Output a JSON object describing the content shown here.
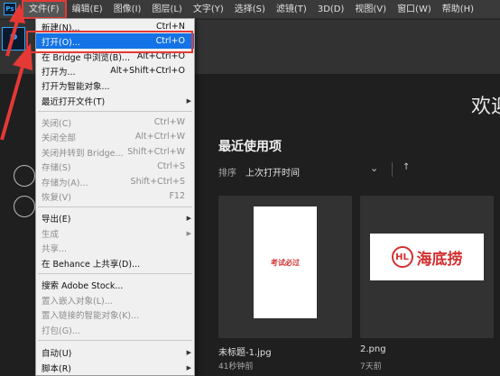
{
  "menubar": {
    "logo": "Ps",
    "items": [
      "文件(F)",
      "编辑(E)",
      "图像(I)",
      "图层(L)",
      "文字(Y)",
      "选择(S)",
      "滤镜(T)",
      "3D(D)",
      "视图(V)",
      "窗口(W)",
      "帮助(H)"
    ]
  },
  "workspace": {
    "logo": "P",
    "welcome": "欢迎",
    "recent_title": "最近使用项",
    "sort_label": "排序",
    "sort_value": "上次打开时间",
    "sort_chevron": "⌄",
    "sort_arrow": "↑"
  },
  "recent_files": [
    {
      "name": "未标题-1.jpg",
      "time": "41秒钟前",
      "thumb_text": "考试必过"
    },
    {
      "name": "2.png",
      "time": "7天前",
      "thumb_logo_mark": "HL",
      "thumb_logo_text": "海底捞"
    }
  ],
  "dropdown": {
    "items": [
      {
        "label": "新建(N)...",
        "shortcut": "Ctrl+N",
        "disabled": false
      },
      {
        "label": "打开(O)...",
        "shortcut": "Ctrl+O",
        "disabled": false,
        "highlight": true
      },
      {
        "label": "在 Bridge 中浏览(B)...",
        "shortcut": "Alt+Ctrl+O",
        "disabled": false
      },
      {
        "label": "打开为...",
        "shortcut": "Alt+Shift+Ctrl+O",
        "disabled": false
      },
      {
        "label": "打开为智能对象...",
        "shortcut": "",
        "disabled": false
      },
      {
        "label": "最近打开文件(T)",
        "shortcut": "",
        "disabled": false,
        "submenu": true
      },
      {
        "label": "关闭(C)",
        "shortcut": "Ctrl+W",
        "disabled": true
      },
      {
        "label": "关闭全部",
        "shortcut": "Alt+Ctrl+W",
        "disabled": true
      },
      {
        "label": "关闭并转到 Bridge...",
        "shortcut": "Shift+Ctrl+W",
        "disabled": true
      },
      {
        "label": "存储(S)",
        "shortcut": "Ctrl+S",
        "disabled": true
      },
      {
        "label": "存储为(A)...",
        "shortcut": "Shift+Ctrl+S",
        "disabled": true
      },
      {
        "label": "恢复(V)",
        "shortcut": "F12",
        "disabled": true
      },
      {
        "label": "导出(E)",
        "shortcut": "",
        "disabled": false,
        "submenu": true
      },
      {
        "label": "生成",
        "shortcut": "",
        "disabled": true,
        "submenu": true
      },
      {
        "label": "共享...",
        "shortcut": "",
        "disabled": true
      },
      {
        "label": "在 Behance 上共享(D)...",
        "shortcut": "",
        "disabled": false
      },
      {
        "label": "搜索 Adobe Stock...",
        "shortcut": "",
        "disabled": false
      },
      {
        "label": "置入嵌入对象(L)...",
        "shortcut": "",
        "disabled": true
      },
      {
        "label": "置入链接的智能对象(K)...",
        "shortcut": "",
        "disabled": true
      },
      {
        "label": "打包(G)...",
        "shortcut": "",
        "disabled": true
      },
      {
        "label": "自动(U)",
        "shortcut": "",
        "disabled": false,
        "submenu": true
      },
      {
        "label": "脚本(R)",
        "shortcut": "",
        "disabled": false,
        "submenu": true
      }
    ]
  },
  "colors": {
    "accent": "#1473e6",
    "annotation": "#e53935",
    "brand": "#31a8ff"
  }
}
